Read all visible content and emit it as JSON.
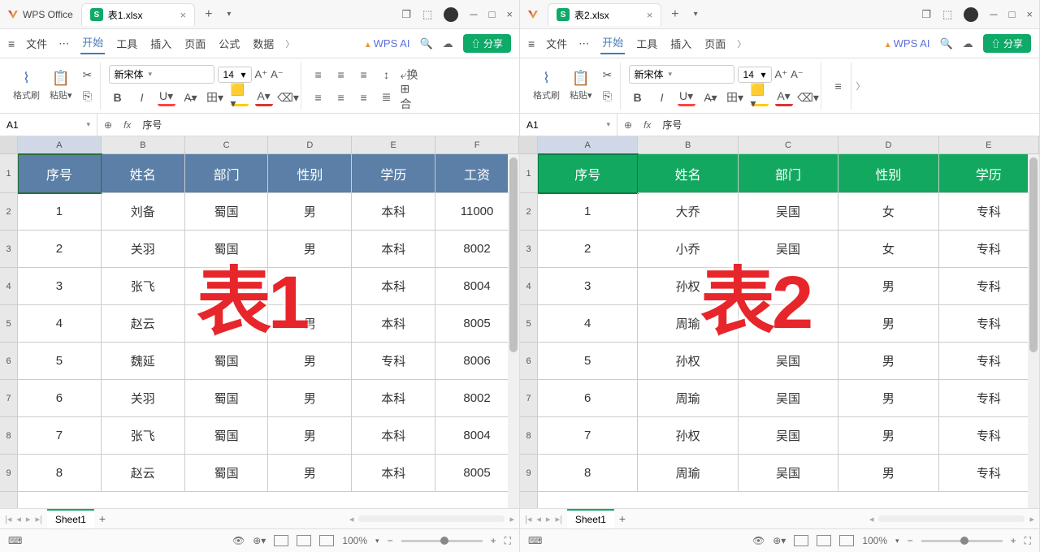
{
  "left": {
    "titlebar": {
      "app_name": "WPS Office",
      "tab_name": "表1.xlsx"
    },
    "menu": {
      "file": "文件",
      "start": "开始",
      "tools": "工具",
      "insert": "插入",
      "page": "页面",
      "formula": "公式",
      "data": "数据",
      "ai": "WPS AI",
      "share": "分享"
    },
    "toolbar": {
      "format_painter": "格式刷",
      "paste": "粘贴",
      "font": "新宋体",
      "size": "14"
    },
    "formula": {
      "cell": "A1",
      "fx": "fx",
      "value": "序号"
    },
    "columns": [
      "A",
      "B",
      "C",
      "D",
      "E",
      "F"
    ],
    "headers": [
      "序号",
      "姓名",
      "部门",
      "性别",
      "学历",
      "工资"
    ],
    "rows": [
      [
        "1",
        "刘备",
        "蜀国",
        "男",
        "本科",
        "11000"
      ],
      [
        "2",
        "关羽",
        "蜀国",
        "男",
        "本科",
        "8002"
      ],
      [
        "3",
        "张飞",
        "",
        "",
        "本科",
        "8004"
      ],
      [
        "4",
        "赵云",
        "",
        "男",
        "本科",
        "8005"
      ],
      [
        "5",
        "魏延",
        "蜀国",
        "男",
        "专科",
        "8006"
      ],
      [
        "6",
        "关羽",
        "蜀国",
        "男",
        "本科",
        "8002"
      ],
      [
        "7",
        "张飞",
        "蜀国",
        "男",
        "本科",
        "8004"
      ],
      [
        "8",
        "赵云",
        "蜀国",
        "男",
        "本科",
        "8005"
      ]
    ],
    "overlay": "表1",
    "sheet": "Sheet1",
    "zoom": "100%"
  },
  "right": {
    "titlebar": {
      "tab_name": "表2.xlsx"
    },
    "menu": {
      "file": "文件",
      "start": "开始",
      "tools": "工具",
      "insert": "插入",
      "page": "页面",
      "ai": "WPS AI",
      "share": "分享"
    },
    "toolbar": {
      "format_painter": "格式刷",
      "paste": "粘贴",
      "font": "新宋体",
      "size": "14"
    },
    "formula": {
      "cell": "A1",
      "fx": "fx",
      "value": "序号"
    },
    "columns": [
      "A",
      "B",
      "C",
      "D",
      "E"
    ],
    "headers": [
      "序号",
      "姓名",
      "部门",
      "性别",
      "学历"
    ],
    "rows": [
      [
        "1",
        "大乔",
        "吴国",
        "女",
        "专科"
      ],
      [
        "2",
        "小乔",
        "吴国",
        "女",
        "专科"
      ],
      [
        "3",
        "孙权",
        "",
        "男",
        "专科"
      ],
      [
        "4",
        "周瑜",
        "",
        "男",
        "专科"
      ],
      [
        "5",
        "孙权",
        "吴国",
        "男",
        "专科"
      ],
      [
        "6",
        "周瑜",
        "吴国",
        "男",
        "专科"
      ],
      [
        "7",
        "孙权",
        "吴国",
        "男",
        "专科"
      ],
      [
        "8",
        "周瑜",
        "吴国",
        "男",
        "专科"
      ]
    ],
    "overlay": "表2",
    "sheet": "Sheet1",
    "zoom": "100%"
  }
}
